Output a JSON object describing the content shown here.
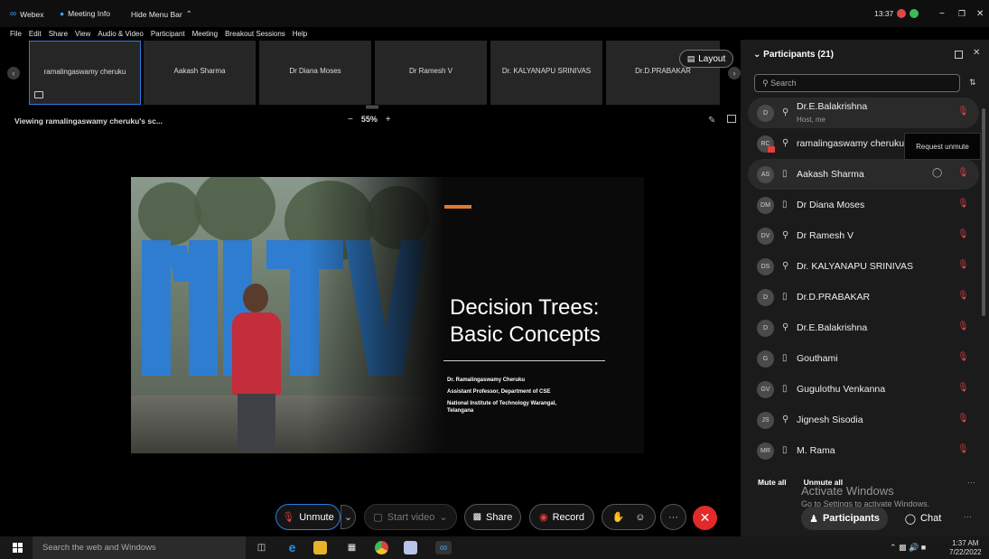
{
  "titlebar": {
    "app": "Webex",
    "meeting_info": "Meeting Info",
    "hide_menu": "Hide Menu Bar",
    "time": "13:37"
  },
  "menu": [
    "File",
    "Edit",
    "Share",
    "View",
    "Audio & Video",
    "Participant",
    "Meeting",
    "Breakout Sessions",
    "Help"
  ],
  "strip": [
    "ramalingaswamy cheruku",
    "Aakash Sharma",
    "Dr Diana Moses",
    "Dr Ramesh V",
    "Dr. KALYANAPU SRINIVAS",
    "Dr.D.PRABAKAR"
  ],
  "layout_label": "Layout",
  "viewing": "Viewing ramalingaswamy cheruku's sc...",
  "zoom": {
    "minus": "−",
    "value": "55%",
    "plus": "+"
  },
  "slide": {
    "title_line1": "Decision Trees:",
    "title_line2": "Basic Concepts",
    "author": "Dr. Ramalingaswamy Cheruku",
    "position": "Assistant Professor, Department of CSE",
    "institute_line1": "National Institute of Technology Warangal,",
    "institute_line2": "Telangana"
  },
  "controls": {
    "unmute": "Unmute",
    "start_video": "Start video",
    "share": "Share",
    "record": "Record",
    "more": "···"
  },
  "panel": {
    "title": "Participants (21)",
    "search_placeholder": "Search",
    "tooltip": "Request unmute",
    "participants": [
      {
        "initials": "D",
        "name": "Dr.E.Balakrishna",
        "sub": "Host, me",
        "device": "headset"
      },
      {
        "initials": "RC",
        "name": "ramalingaswamy cheruku",
        "sub": "",
        "device": "headset"
      },
      {
        "initials": "AS",
        "name": "Aakash Sharma",
        "sub": "",
        "device": "phone"
      },
      {
        "initials": "DM",
        "name": "Dr Diana Moses",
        "sub": "",
        "device": "phone"
      },
      {
        "initials": "DV",
        "name": "Dr Ramesh V",
        "sub": "",
        "device": "headset"
      },
      {
        "initials": "DS",
        "name": "Dr. KALYANAPU SRINIVAS",
        "sub": "",
        "device": "headset"
      },
      {
        "initials": "D",
        "name": "Dr.D.PRABAKAR",
        "sub": "",
        "device": "phone"
      },
      {
        "initials": "D",
        "name": "Dr.E.Balakrishna",
        "sub": "",
        "device": "headset"
      },
      {
        "initials": "G",
        "name": "Gouthami",
        "sub": "",
        "device": "phone"
      },
      {
        "initials": "GV",
        "name": "Gugulothu Venkanna",
        "sub": "",
        "device": "phone"
      },
      {
        "initials": "JS",
        "name": "Jignesh Sisodia",
        "sub": "",
        "device": "headset"
      },
      {
        "initials": "MR",
        "name": "M. Rama",
        "sub": "",
        "device": "phone"
      }
    ],
    "mute_all": "Mute all",
    "unmute_all": "Unmute all",
    "tab_participants": "Participants",
    "tab_chat": "Chat"
  },
  "watermark": {
    "line1": "Activate Windows",
    "line2": "Go to Settings to activate Windows."
  },
  "taskbar": {
    "search": "Search the web and Windows",
    "time": "1:37 AM",
    "date": "7/22/2022"
  },
  "colors": {
    "accent_red": "#e22a2a",
    "mic_muted": "#e04040",
    "slide_orange": "#e07a2f",
    "selection_blue": "#2c7be5"
  }
}
